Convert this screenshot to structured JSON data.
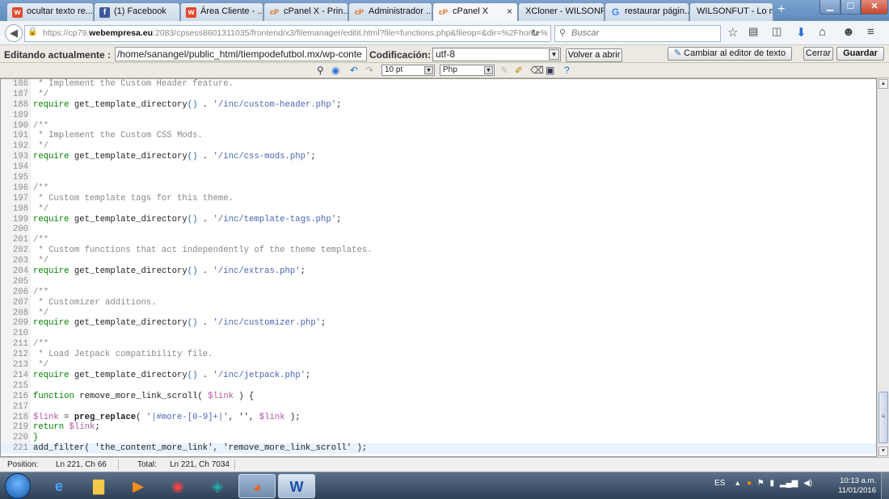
{
  "browser": {
    "tabs": [
      {
        "label": "ocultar texto re...",
        "icon": "w-icon"
      },
      {
        "label": "(1) Facebook",
        "icon": "facebook-icon"
      },
      {
        "label": "Área Cliente - ...",
        "icon": "w-icon"
      },
      {
        "label": "cPanel X - Prin...",
        "icon": "cpanel-icon"
      },
      {
        "label": "Administrador ...",
        "icon": "cpanel-icon"
      },
      {
        "label": "cPanel X",
        "icon": "cpanel-icon",
        "active": true
      },
      {
        "label": "XCloner - WILSONF...",
        "icon": "none"
      },
      {
        "label": "restaurar págin...",
        "icon": "google-icon"
      },
      {
        "label": "WILSONFUT - Lo m...",
        "icon": "none"
      }
    ],
    "new_tab": "+",
    "url_prefix": "https://cp79.",
    "url_domain": "webempresa.eu",
    "url_rest": ":2083/cpsess8601311035/frontend/x3/filemanager/editit.html?file=functions.php&fileop=&dir=%2Fhome%",
    "search_placeholder": "Buscar"
  },
  "editor": {
    "label": "Editando actualmente :",
    "path": "/home/sanangel/public_html/tiempodefutbol.mx/wp-conte",
    "encoding_label": "Codificación:",
    "encoding": "utf-8",
    "back_button": "Volver a abrir",
    "switch_editor_button": "Cambiar al editor de texto",
    "close_button": "Cerrar",
    "save_button": "Guardar",
    "font_size": "10 pt",
    "language": "Php"
  },
  "code_lines": [
    {
      "n": "186",
      "t": " * Implement the Custom Header feature.",
      "type": "cm"
    },
    {
      "n": "187",
      "t": " */",
      "type": "cm"
    },
    {
      "n": "188",
      "t": "require get_template_directory() . '/inc/custom-header.php';",
      "type": "req"
    },
    {
      "n": "189",
      "t": "",
      "type": "plain"
    },
    {
      "n": "190",
      "t": "/**",
      "type": "cm"
    },
    {
      "n": "191",
      "t": " * Implement the Custom CSS Mods.",
      "type": "cm"
    },
    {
      "n": "192",
      "t": " */",
      "type": "cm"
    },
    {
      "n": "193",
      "t": "require get_template_directory() . '/inc/css-mods.php';",
      "type": "req"
    },
    {
      "n": "194",
      "t": "",
      "type": "plain"
    },
    {
      "n": "195",
      "t": "",
      "type": "plain"
    },
    {
      "n": "196",
      "t": "/**",
      "type": "cm"
    },
    {
      "n": "197",
      "t": " * Custom template tags for this theme.",
      "type": "cm"
    },
    {
      "n": "198",
      "t": " */",
      "type": "cm"
    },
    {
      "n": "199",
      "t": "require get_template_directory() . '/inc/template-tags.php';",
      "type": "req"
    },
    {
      "n": "200",
      "t": "",
      "type": "plain"
    },
    {
      "n": "201",
      "t": "/**",
      "type": "cm"
    },
    {
      "n": "202",
      "t": " * Custom functions that act independently of the theme templates.",
      "type": "cm"
    },
    {
      "n": "203",
      "t": " */",
      "type": "cm"
    },
    {
      "n": "204",
      "t": "require get_template_directory() . '/inc/extras.php';",
      "type": "req"
    },
    {
      "n": "205",
      "t": "",
      "type": "plain"
    },
    {
      "n": "206",
      "t": "/**",
      "type": "cm"
    },
    {
      "n": "207",
      "t": " * Customizer additions.",
      "type": "cm"
    },
    {
      "n": "208",
      "t": " */",
      "type": "cm"
    },
    {
      "n": "209",
      "t": "require get_template_directory() . '/inc/customizer.php';",
      "type": "req"
    },
    {
      "n": "210",
      "t": "",
      "type": "plain"
    },
    {
      "n": "211",
      "t": "/**",
      "type": "cm"
    },
    {
      "n": "212",
      "t": " * Load Jetpack compatibility file.",
      "type": "cm"
    },
    {
      "n": "213",
      "t": " */",
      "type": "cm"
    },
    {
      "n": "214",
      "t": "require get_template_directory() . '/inc/jetpack.php';",
      "type": "req"
    },
    {
      "n": "215",
      "t": "",
      "type": "plain"
    },
    {
      "n": "216",
      "t": "function remove_more_link_scroll( $link ) {",
      "type": "func"
    },
    {
      "n": "217",
      "t": "",
      "type": "plain"
    },
    {
      "n": "218",
      "t": "$link = preg_replace( '|#more-[0-9]+|', '', $link );",
      "type": "assign"
    },
    {
      "n": "219",
      "t": "return $link;",
      "type": "ret"
    },
    {
      "n": "220",
      "t": "}",
      "type": "kwline"
    },
    {
      "n": "221",
      "t": "add_filter( 'the_content_more_link', 'remove_more_link_scroll' );",
      "type": "plain",
      "current": true
    }
  ],
  "status": {
    "position_label": "Position:",
    "position": "Ln 221, Ch 66",
    "total_label": "Total:",
    "total": "Ln 221, Ch 7034"
  },
  "taskbar": {
    "lang": "ES",
    "time": "10:13 a.m.",
    "date": "11/01/2016"
  }
}
